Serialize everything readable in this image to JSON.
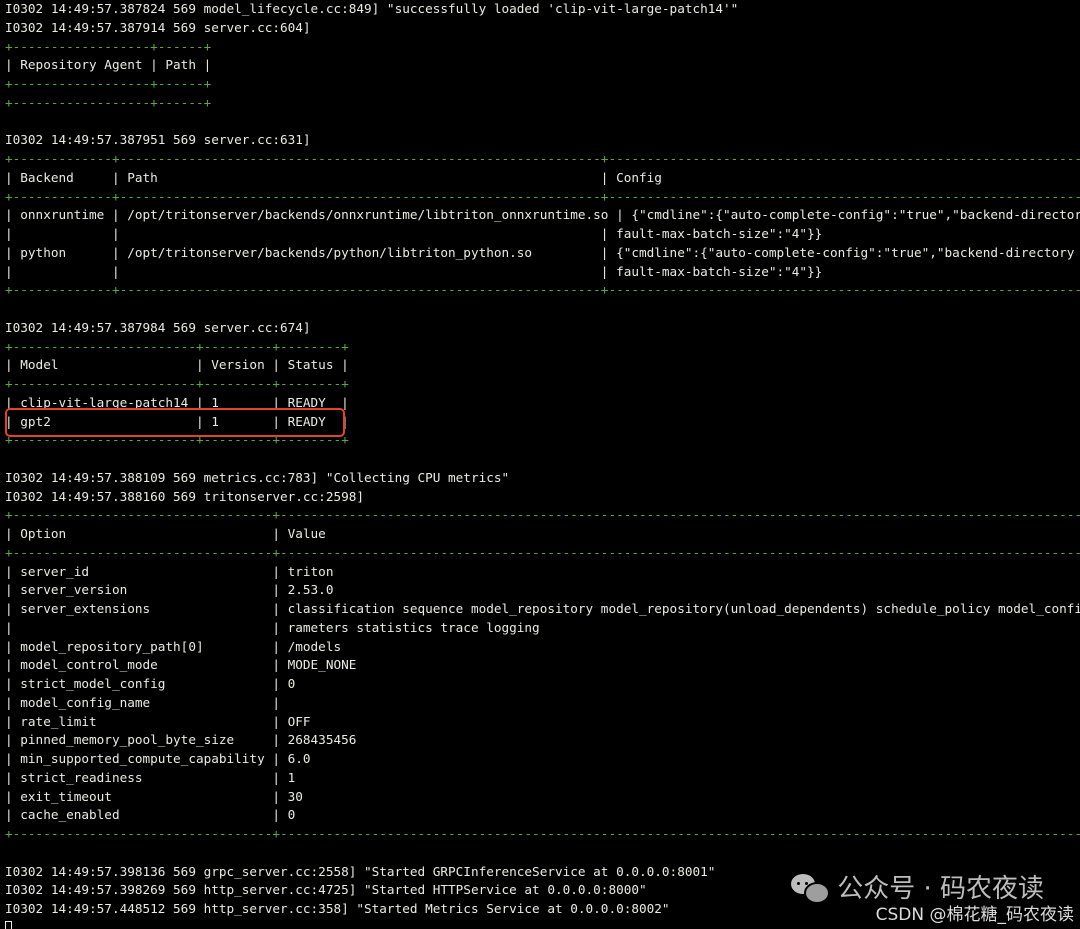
{
  "terminal": {
    "lines": [
      {
        "text": "I0302 14:49:57.387824 569 model_lifecycle.cc:849] \"successfully loaded 'clip-vit-large-patch14'\"",
        "kind": "log"
      },
      {
        "text": "I0302 14:49:57.387914 569 server.cc:604]",
        "kind": "log"
      },
      {
        "text": "+------------------+------+",
        "kind": "sep"
      },
      {
        "text": "| Repository Agent | Path |",
        "kind": "row"
      },
      {
        "text": "+------------------+------+",
        "kind": "sep"
      },
      {
        "text": "+------------------+------+",
        "kind": "sep"
      },
      {
        "text": "",
        "kind": "blank"
      },
      {
        "text": "I0302 14:49:57.387951 569 server.cc:631]",
        "kind": "log"
      },
      {
        "text": "+-------------+---------------------------------------------------------------+----------------------------------------------------------------------------------------------------",
        "kind": "sep"
      },
      {
        "text": "| Backend     | Path                                                          | Config",
        "kind": "row"
      },
      {
        "text": "+-------------+---------------------------------------------------------------+----------------------------------------------------------------------------------------------------",
        "kind": "sep"
      },
      {
        "text": "| onnxruntime | /opt/tritonserver/backends/onnxruntime/libtriton_onnxruntime.so | {\"cmdline\":{\"auto-complete-config\":\"true\",\"backend-directory",
        "kind": "row"
      },
      {
        "text": "|             |                                                               | fault-max-batch-size\":\"4\"}}",
        "kind": "row"
      },
      {
        "text": "| python      | /opt/tritonserver/backends/python/libtriton_python.so         | {\"cmdline\":{\"auto-complete-config\":\"true\",\"backend-directory",
        "kind": "row"
      },
      {
        "text": "|             |                                                               | fault-max-batch-size\":\"4\"}}",
        "kind": "row"
      },
      {
        "text": "+-------------+---------------------------------------------------------------+----------------------------------------------------------------------------------------------------",
        "kind": "sep"
      },
      {
        "text": "",
        "kind": "blank"
      },
      {
        "text": "I0302 14:49:57.387984 569 server.cc:674]",
        "kind": "log"
      },
      {
        "text": "+------------------------+---------+--------+",
        "kind": "sep"
      },
      {
        "text": "| Model                  | Version | Status |",
        "kind": "row"
      },
      {
        "text": "+------------------------+---------+--------+",
        "kind": "sep"
      },
      {
        "text": "| clip-vit-large-patch14 | 1       | READY  |",
        "kind": "row"
      },
      {
        "text": "| gpt2                   | 1       | READY  |",
        "kind": "row"
      },
      {
        "text": "+------------------------+---------+--------+",
        "kind": "sep"
      },
      {
        "text": "",
        "kind": "blank"
      },
      {
        "text": "I0302 14:49:57.388109 569 metrics.cc:783] \"Collecting CPU metrics\"",
        "kind": "log"
      },
      {
        "text": "I0302 14:49:57.388160 569 tritonserver.cc:2598]",
        "kind": "log"
      },
      {
        "text": "+----------------------------------+-----------------------------------------------------------------------------------------------------------------------------------------------------",
        "kind": "sep"
      },
      {
        "text": "| Option                           | Value",
        "kind": "row"
      },
      {
        "text": "+----------------------------------+-----------------------------------------------------------------------------------------------------------------------------------------------------",
        "kind": "sep"
      },
      {
        "text": "| server_id                        | triton",
        "kind": "row"
      },
      {
        "text": "| server_version                   | 2.53.0",
        "kind": "row"
      },
      {
        "text": "| server_extensions                | classification sequence model_repository model_repository(unload_dependents) schedule_policy model_config",
        "kind": "row"
      },
      {
        "text": "|                                  | rameters statistics trace logging",
        "kind": "row"
      },
      {
        "text": "| model_repository_path[0]         | /models",
        "kind": "row"
      },
      {
        "text": "| model_control_mode               | MODE_NONE",
        "kind": "row"
      },
      {
        "text": "| strict_model_config              | 0",
        "kind": "row"
      },
      {
        "text": "| model_config_name                |",
        "kind": "row"
      },
      {
        "text": "| rate_limit                       | OFF",
        "kind": "row"
      },
      {
        "text": "| pinned_memory_pool_byte_size     | 268435456",
        "kind": "row"
      },
      {
        "text": "| min_supported_compute_capability | 6.0",
        "kind": "row"
      },
      {
        "text": "| strict_readiness                 | 1",
        "kind": "row"
      },
      {
        "text": "| exit_timeout                     | 30",
        "kind": "row"
      },
      {
        "text": "| cache_enabled                    | 0",
        "kind": "row"
      },
      {
        "text": "+----------------------------------+-----------------------------------------------------------------------------------------------------------------------------------------------------",
        "kind": "sep"
      },
      {
        "text": "",
        "kind": "blank"
      },
      {
        "text": "I0302 14:49:57.398136 569 grpc_server.cc:2558] \"Started GRPCInferenceService at 0.0.0.0:8001\"",
        "kind": "log"
      },
      {
        "text": "I0302 14:49:57.398269 569 http_server.cc:4725] \"Started HTTPService at 0.0.0.0:8000\"",
        "kind": "log"
      },
      {
        "text": "I0302 14:49:57.448512 569 http_server.cc:358] \"Started Metrics Service at 0.0.0.0:8002\"",
        "kind": "log"
      }
    ]
  },
  "watermark": {
    "text": "公众号 · 码农夜读",
    "icon": "wechat-icon"
  },
  "credit": {
    "text": "CSDN @棉花糖_码农夜读"
  },
  "colors": {
    "background": "#000000",
    "text": "#e9ece1",
    "separator": "#5aa845",
    "highlight": "#e0442f"
  }
}
